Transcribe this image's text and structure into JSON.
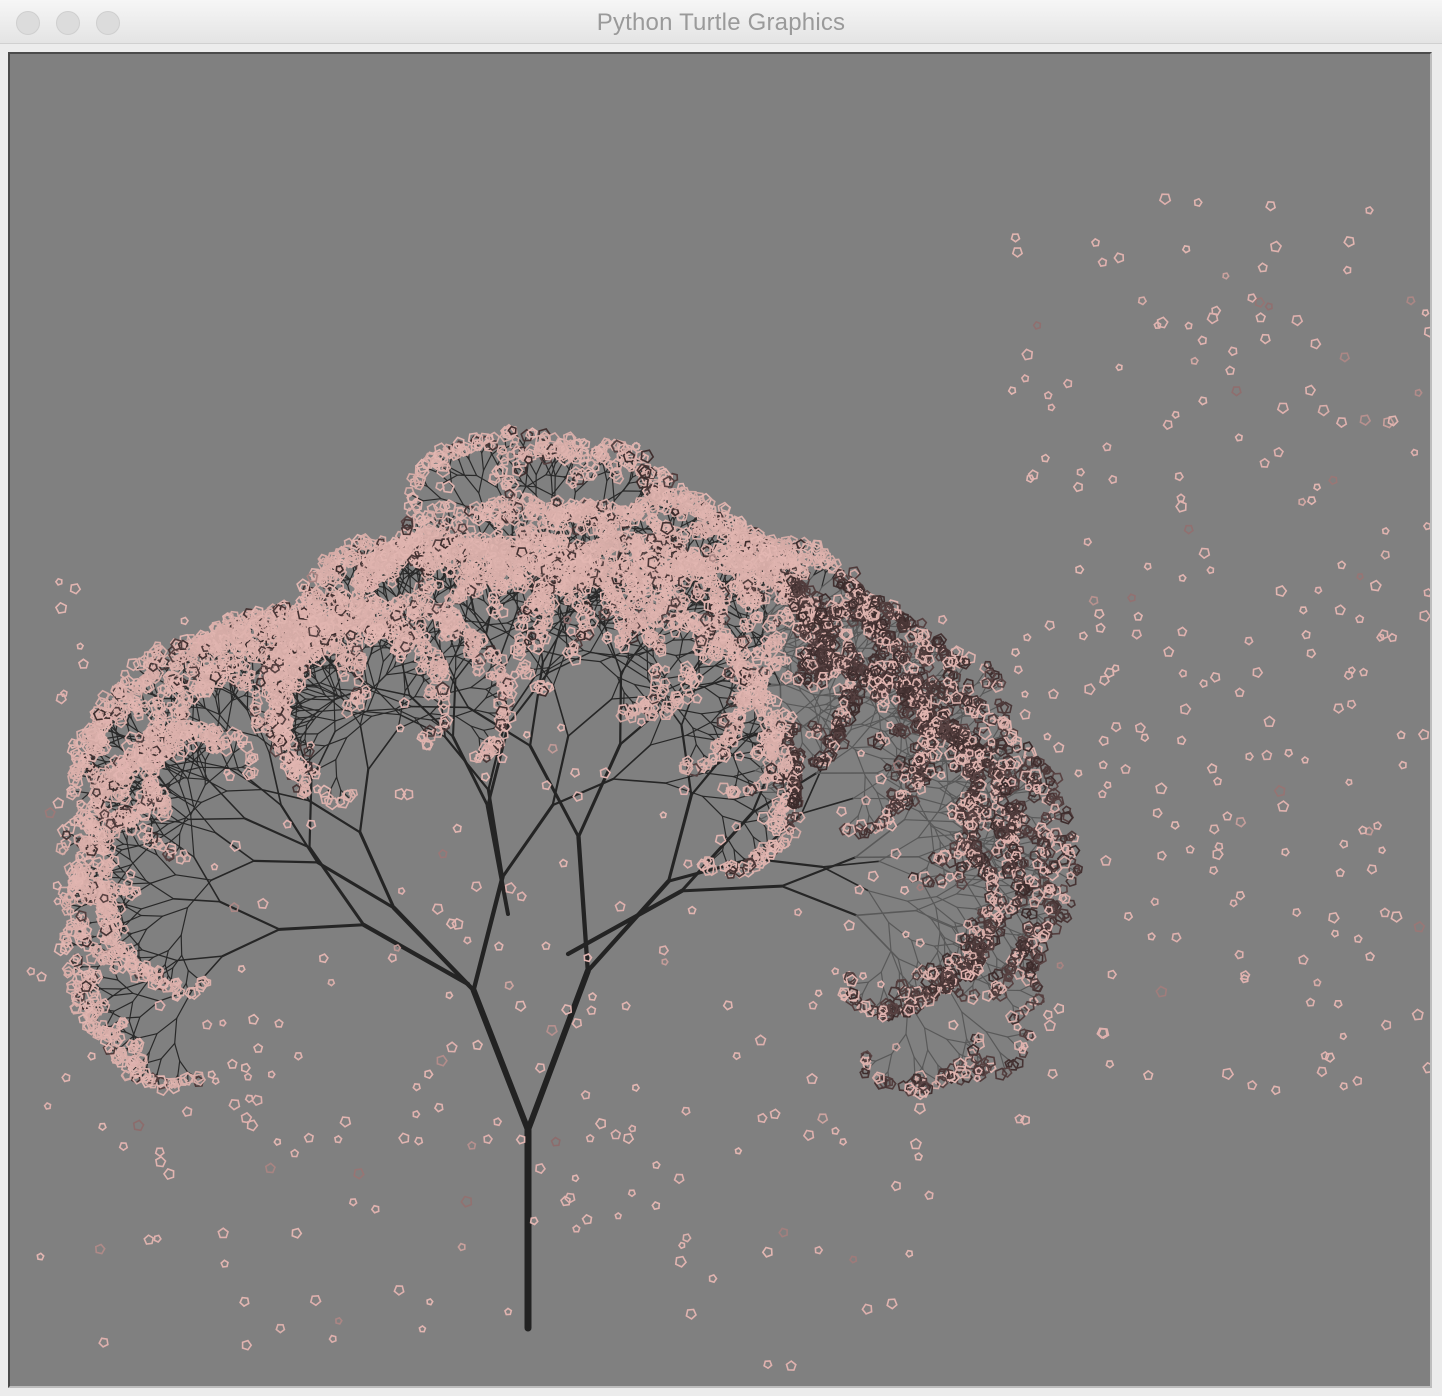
{
  "window": {
    "title": "Python Turtle Graphics"
  },
  "canvas": {
    "background_color": "#808080",
    "branch_color_dark": "#222222",
    "branch_color_light": "#595959",
    "petal_color_light": "#e3b7b2",
    "petal_color_dark": "#3a2a2a"
  },
  "icons": {
    "close": "close-icon",
    "minimize": "minimize-icon",
    "zoom": "zoom-icon"
  }
}
